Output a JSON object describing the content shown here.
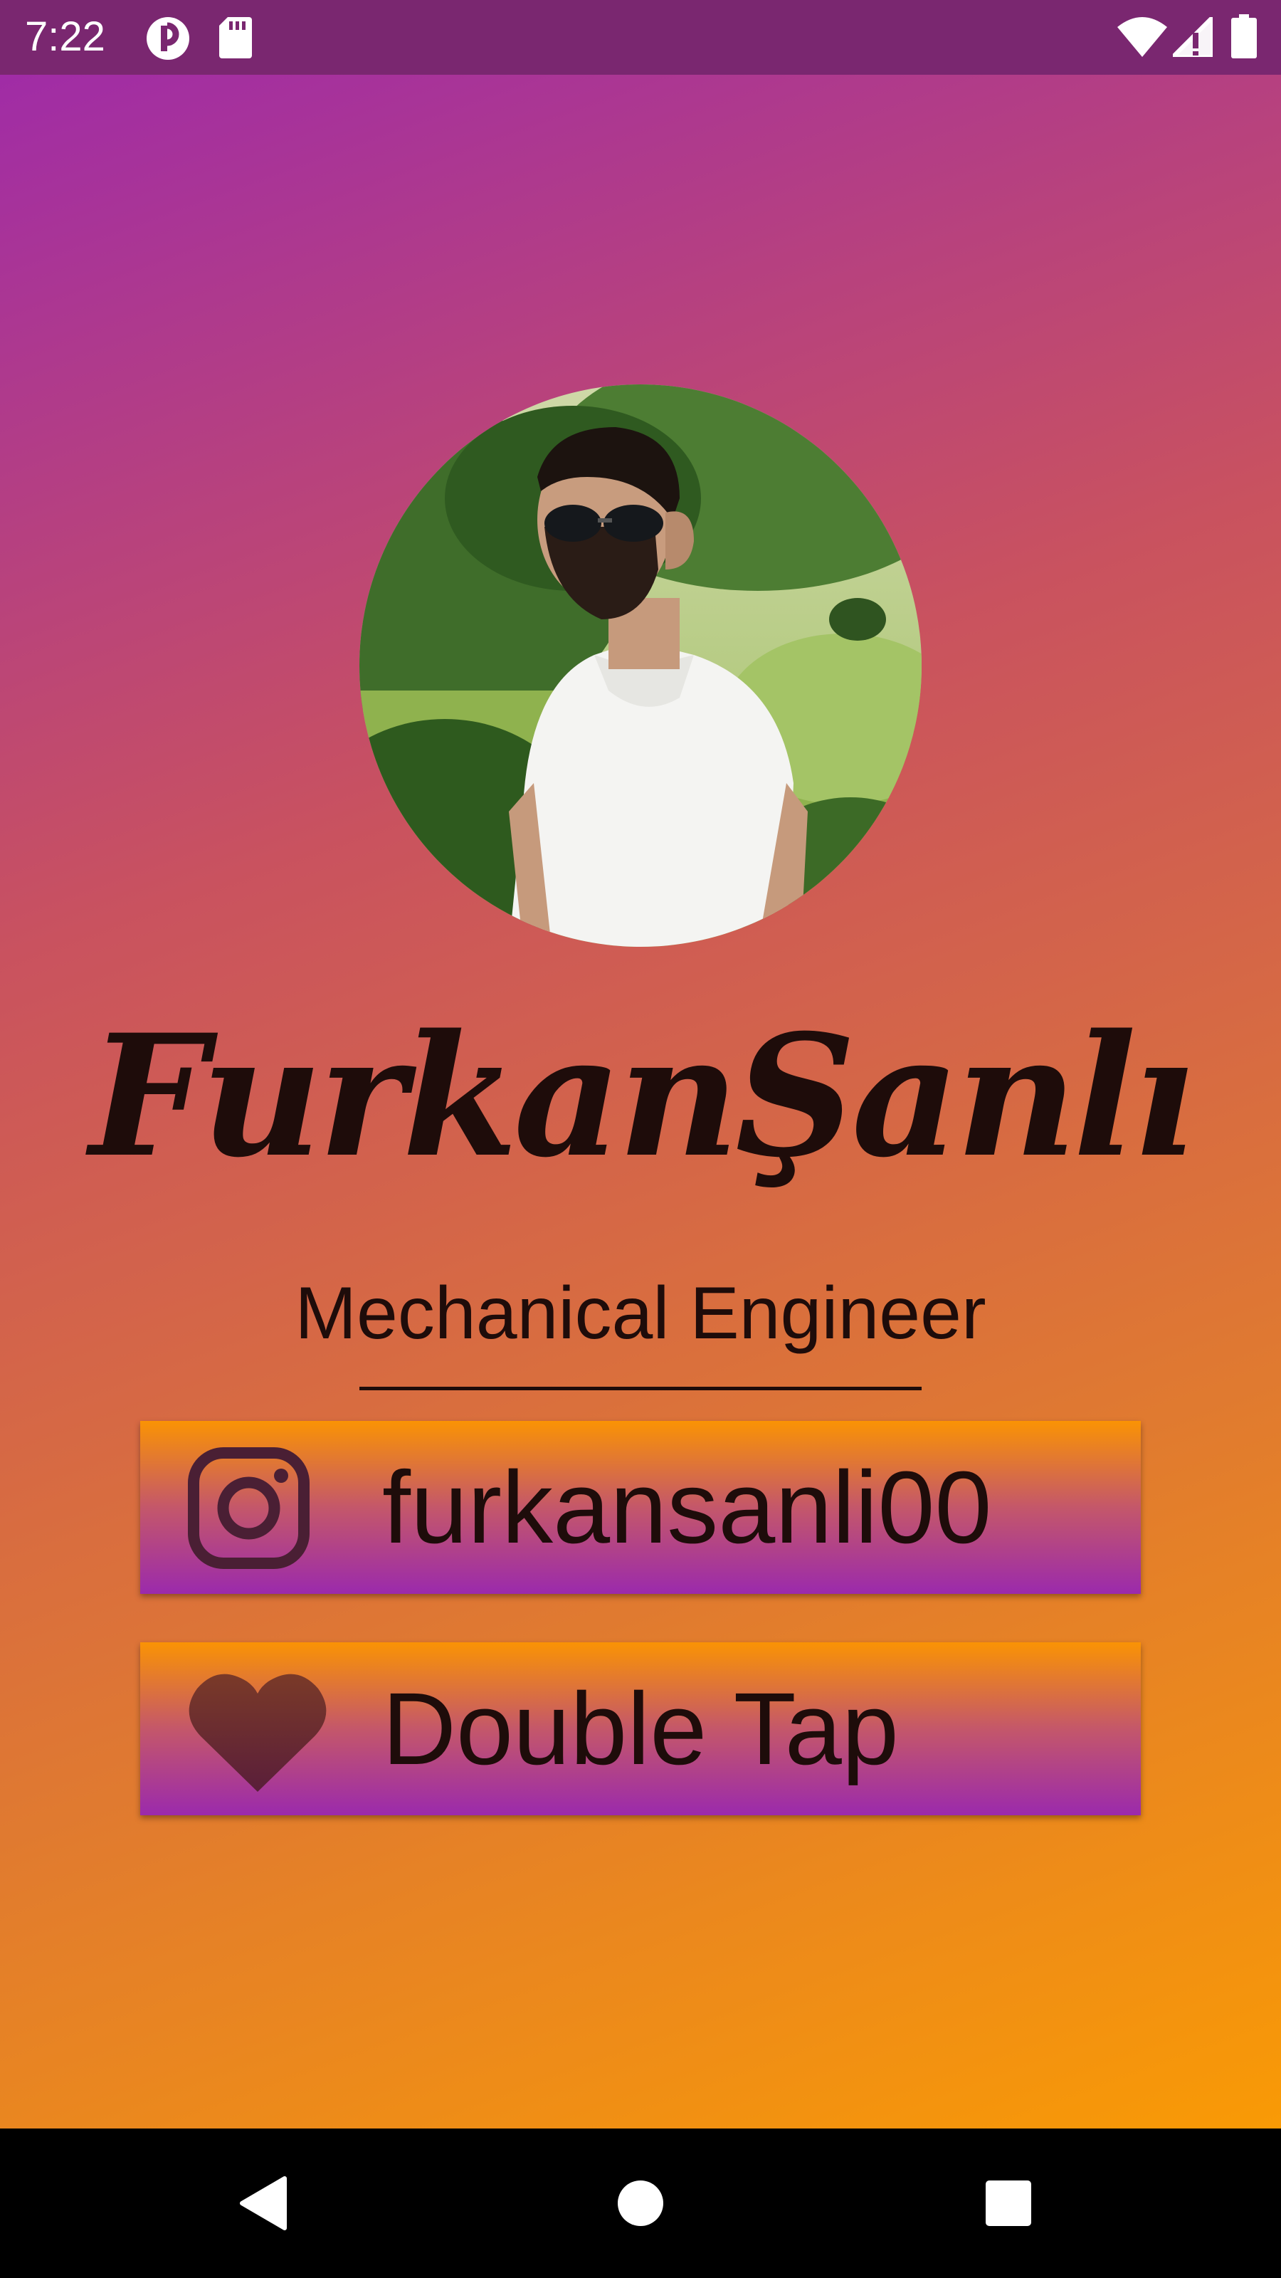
{
  "status_bar": {
    "time": "7:22",
    "icons": [
      "notification-app-icon",
      "sd-card-icon",
      "wifi-icon",
      "cellular-signal-icon",
      "battery-icon"
    ]
  },
  "profile": {
    "photo": "profile-photo",
    "name": "FurkanŞanlı",
    "job_title": "Mechanical Engineer"
  },
  "cards": {
    "instagram": {
      "icon": "instagram-icon",
      "label": "furkansanli00"
    },
    "double_tap": {
      "icon": "heart-icon",
      "label": "Double Tap"
    }
  },
  "navigation_bar": {
    "buttons": [
      "back-icon",
      "home-icon",
      "recents-icon"
    ]
  },
  "colors": {
    "gradient_top": "#a02ca6",
    "gradient_bottom": "#f99a05",
    "card_top": "#fa9304",
    "card_bottom": "#9b2aac",
    "text_dark": "#1e0c0a",
    "status_bar": "#7a2770"
  }
}
